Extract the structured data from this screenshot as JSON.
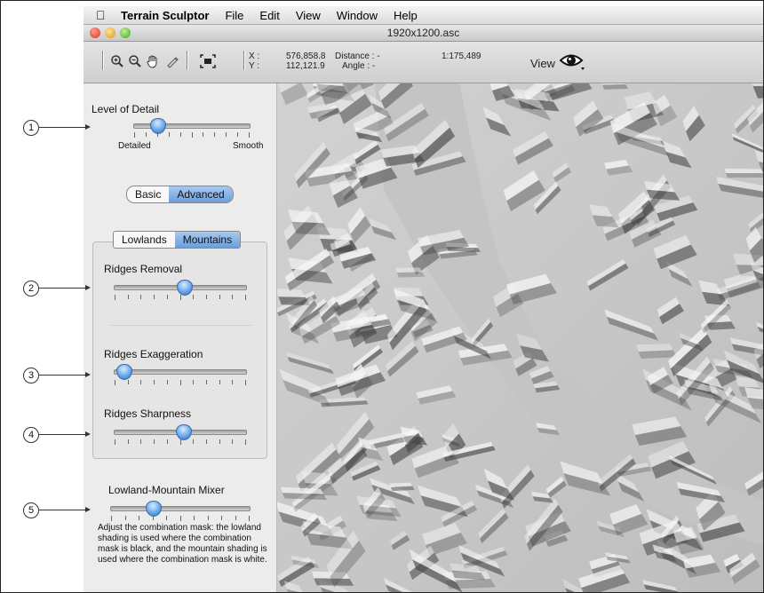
{
  "menubar": {
    "app_name": "Terrain Sculptor",
    "items": [
      "File",
      "Edit",
      "View",
      "Window",
      "Help"
    ]
  },
  "window": {
    "title": "1920x1200.asc"
  },
  "toolbar": {
    "tools": [
      "zoom-in-icon",
      "zoom-out-icon",
      "hand-icon",
      "measure-icon",
      "fit-extent-icon"
    ],
    "x_label": "X :",
    "y_label": "Y :",
    "x_value": "576,858.8",
    "y_value": "112,121.9",
    "distance_label": "Distance : -",
    "angle_label": "Angle : -",
    "scale": "1:175,489",
    "view_label": "View"
  },
  "sidebar": {
    "level_of_detail": {
      "title": "Level of Detail",
      "min_label": "Detailed",
      "max_label": "Smooth",
      "value": 0.2
    },
    "mode_toggle": {
      "options": [
        "Basic",
        "Advanced"
      ],
      "selected": "Advanced"
    },
    "terrain_tabs": {
      "options": [
        "Lowlands",
        "Mountains"
      ],
      "selected": "Mountains"
    },
    "ridges_removal": {
      "title": "Ridges Removal",
      "value": 0.53
    },
    "ridges_exaggeration": {
      "title": "Ridges Exaggeration",
      "value": 0.07
    },
    "ridges_sharpness": {
      "title": "Ridges Sharpness",
      "value": 0.52
    },
    "mixer": {
      "title": "Lowland-Mountain Mixer",
      "value": 0.3
    },
    "mixer_description": "Adjust the combination mask: the lowland shading is used where the combination mask is black, and the mountain shading is used where the combination mask is white."
  },
  "callouts": [
    "1",
    "2",
    "3",
    "4",
    "5"
  ]
}
